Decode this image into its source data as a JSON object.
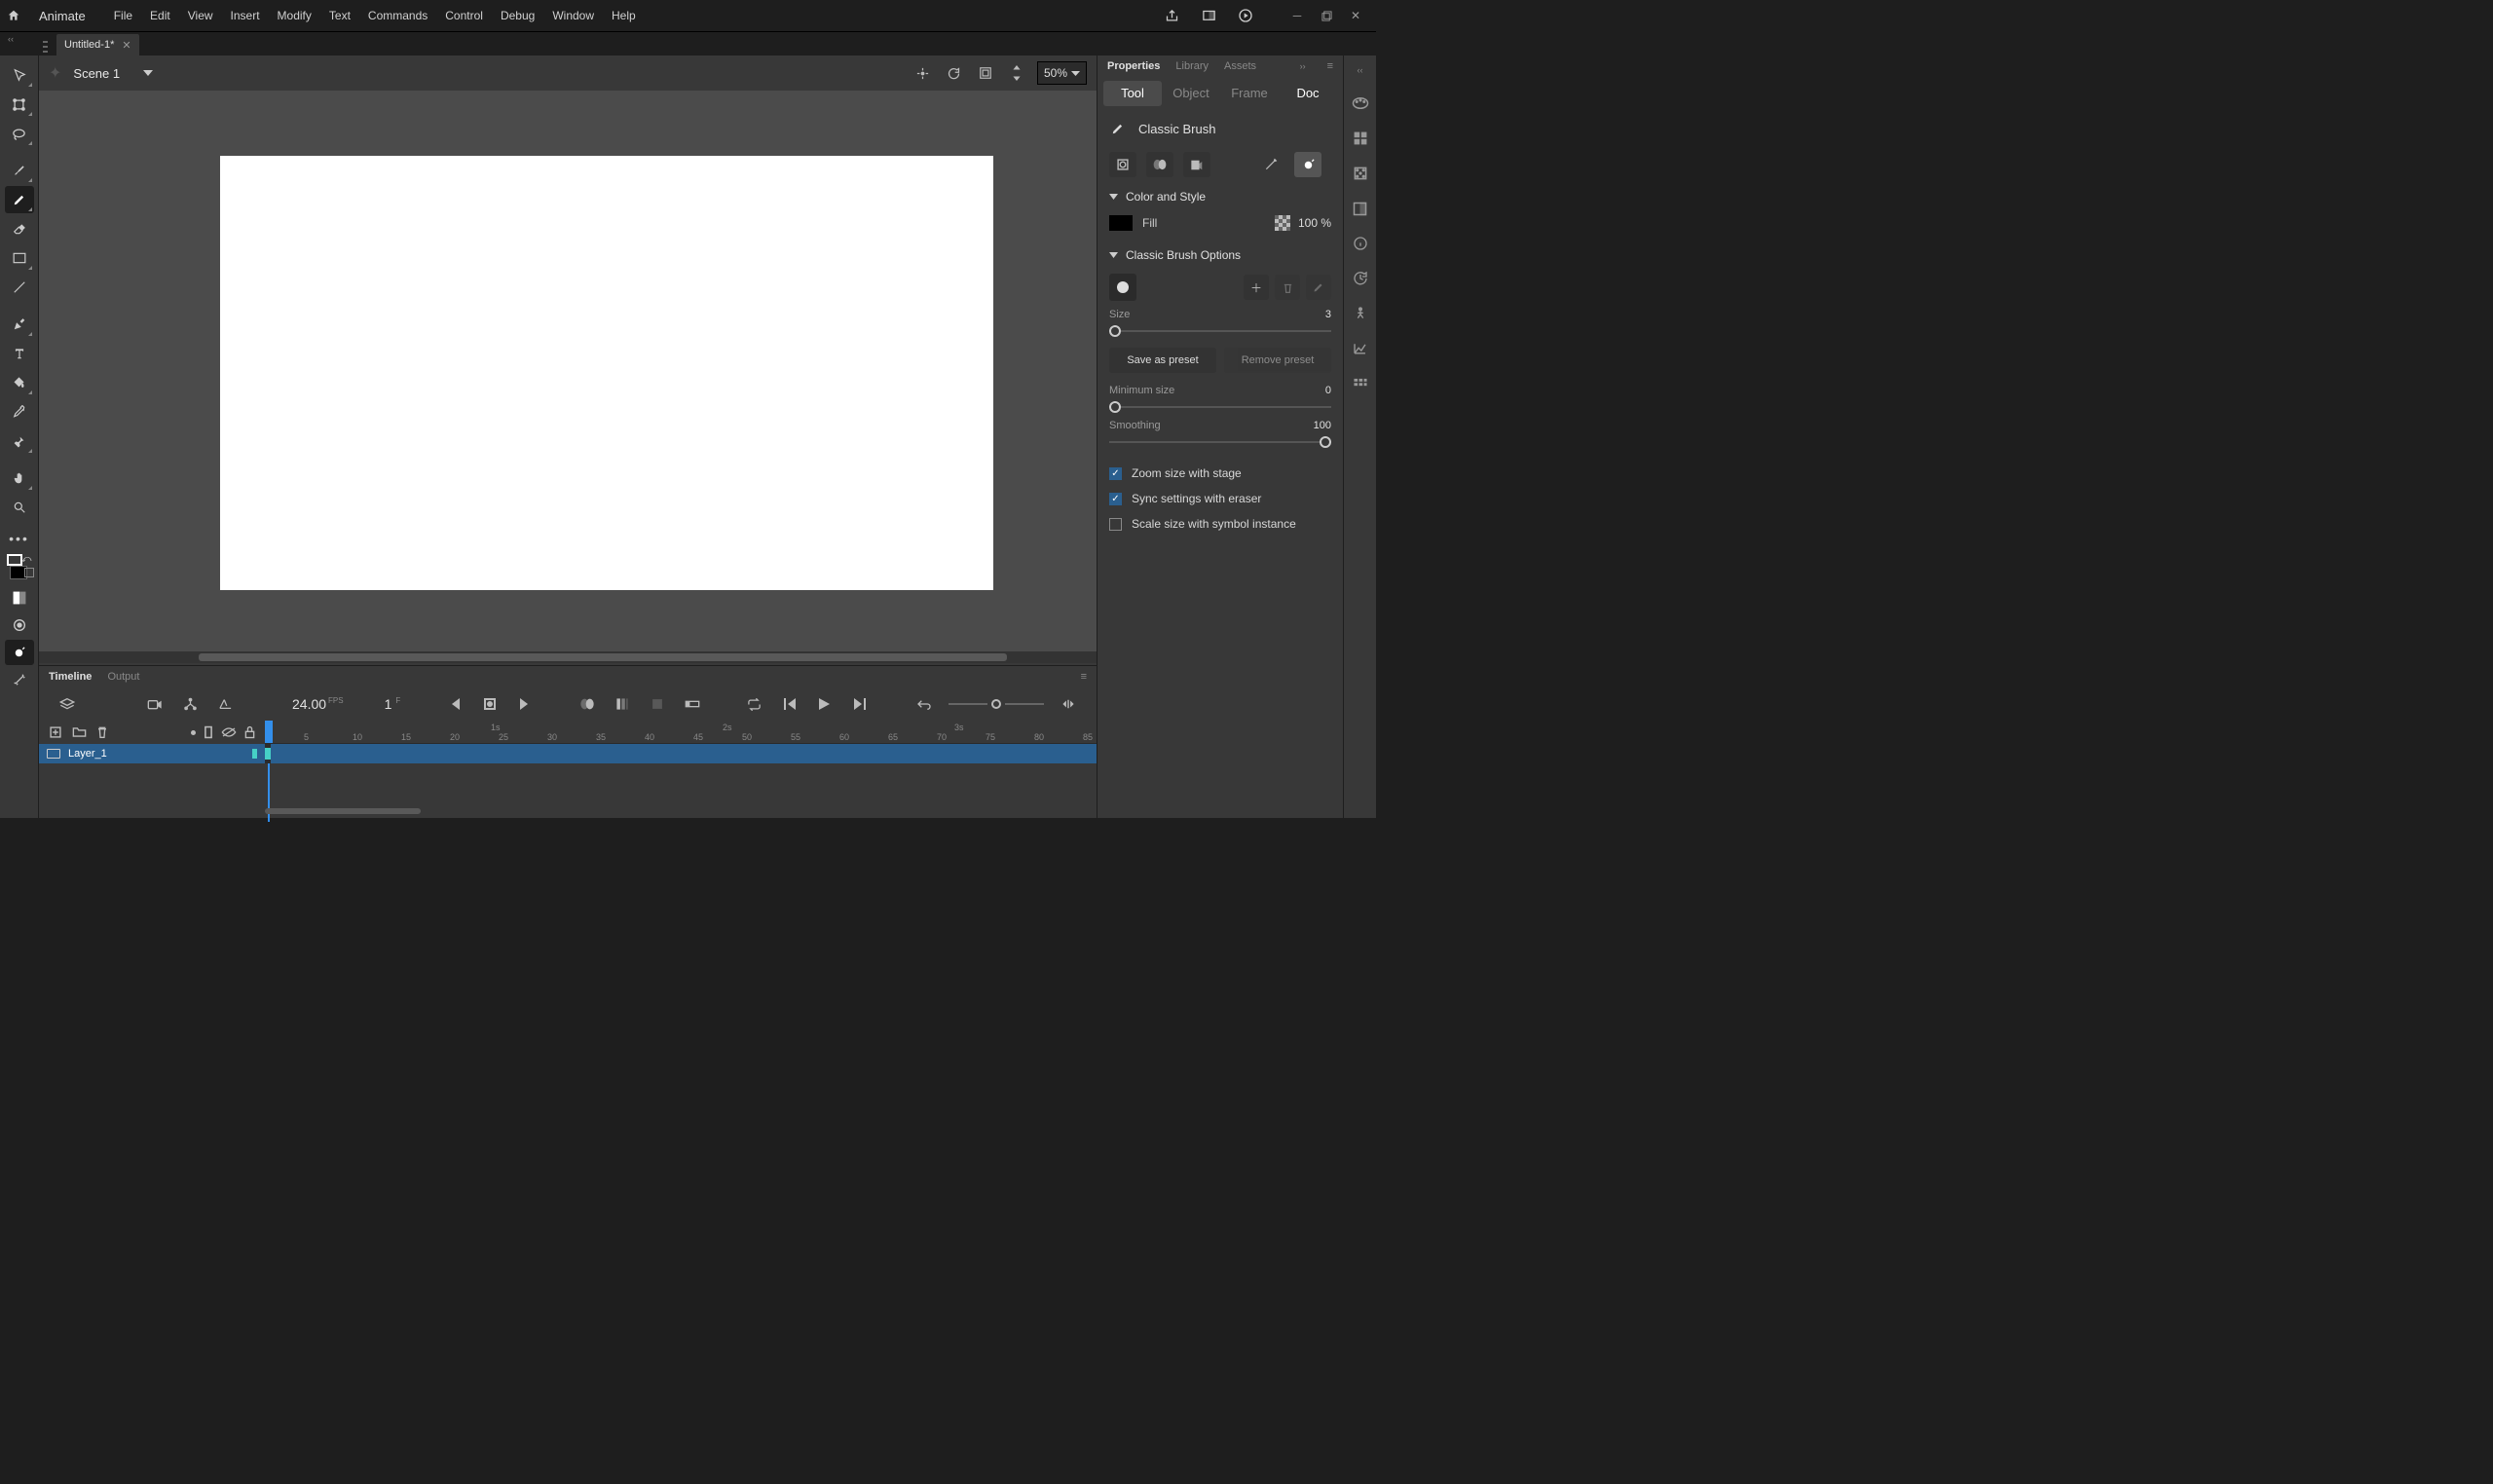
{
  "app": {
    "name": "Animate"
  },
  "menu": [
    "File",
    "Edit",
    "View",
    "Insert",
    "Modify",
    "Text",
    "Commands",
    "Control",
    "Debug",
    "Window",
    "Help"
  ],
  "document": {
    "tab_name": "Untitled-1*",
    "scene": "Scene 1",
    "zoom": "50%"
  },
  "timeline": {
    "tabs": [
      "Timeline",
      "Output"
    ],
    "active_tab": 0,
    "fps": "24.00",
    "fps_label": "FPS",
    "current_frame": "1",
    "frame_label": "F",
    "layer": "Layer_1",
    "second_marks": [
      "1s",
      "2s",
      "3s"
    ],
    "frame_nums": [
      5,
      10,
      15,
      20,
      25,
      30,
      35,
      40,
      45,
      50,
      55,
      60,
      65,
      70,
      75,
      80,
      85
    ]
  },
  "properties": {
    "panel_tabs": [
      "Properties",
      "Library",
      "Assets"
    ],
    "active_panel": 0,
    "subtabs": [
      "Tool",
      "Object",
      "Frame",
      "Doc"
    ],
    "active_sub": 0,
    "tool_name": "Classic Brush",
    "sections": {
      "color": "Color and Style",
      "brush": "Classic Brush Options"
    },
    "fill": {
      "label": "Fill",
      "alpha": "100 %"
    },
    "size": {
      "label": "Size",
      "value": "3"
    },
    "save_preset": "Save as preset",
    "remove_preset": "Remove preset",
    "min_size": {
      "label": "Minimum size",
      "value": "0"
    },
    "smoothing": {
      "label": "Smoothing",
      "value": "100"
    },
    "checks": {
      "zoom_stage": "Zoom size with stage",
      "sync_eraser": "Sync settings with eraser",
      "scale_symbol": "Scale size with symbol instance"
    }
  }
}
